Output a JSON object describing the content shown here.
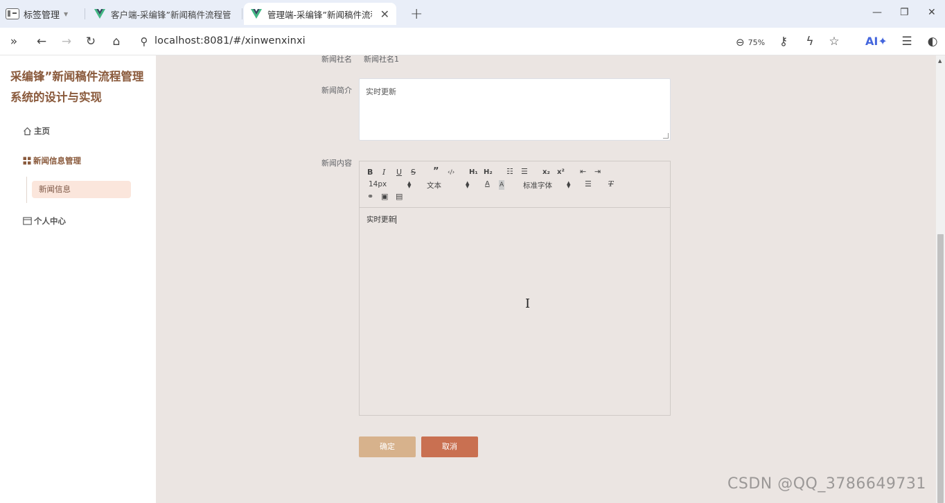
{
  "browser": {
    "tab_manager_label": "标签管理",
    "tabs": [
      {
        "title": "客户端-采编锋”新闻稿件流程管"
      },
      {
        "title": "管理端-采编锋”新闻稿件流程"
      }
    ],
    "new_tab_symbol": "+",
    "url": "localhost:8081/#/xinwenxinxi",
    "zoom": "75%",
    "ai_label": "AI✦"
  },
  "sidebar": {
    "title": "采编锋”新闻稿件流程管理系统的设计与实现",
    "items": [
      {
        "label": "主页",
        "icon": "home-icon"
      },
      {
        "label": "新闻信息管理",
        "icon": "grid-icon"
      },
      {
        "label": "个人中心",
        "icon": "calendar-icon"
      }
    ],
    "sub_items": [
      {
        "label": "新闻信息"
      }
    ]
  },
  "form": {
    "fields": [
      {
        "label": "新闻社名",
        "value": "新闻社名1"
      },
      {
        "label": "新闻简介",
        "value": "实时更新"
      },
      {
        "label": "新闻内容",
        "value": "实时更新"
      }
    ],
    "editor": {
      "font_size": "14px",
      "block_type": "文本",
      "font_family": "标准字体"
    },
    "confirm_label": "确定",
    "cancel_label": "取消"
  },
  "watermark": "CSDN @QQ_3786649731",
  "colors": {
    "accent_brown": "#8a5a3c",
    "confirm_bg": "#d7b28c",
    "cancel_bg": "#c97051",
    "content_bg": "#ebe5e2",
    "active_sub_bg": "#fbe6dc"
  }
}
